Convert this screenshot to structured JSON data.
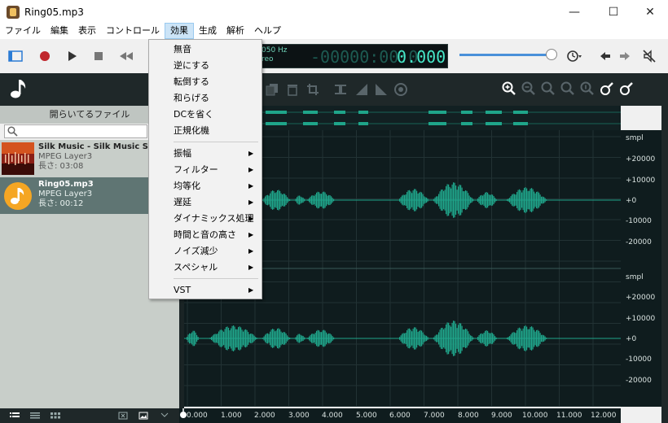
{
  "window": {
    "title": "Ring05.mp3"
  },
  "menubar": {
    "items": [
      "ファイル",
      "編集",
      "表示",
      "コントロール",
      "効果",
      "生成",
      "解析",
      "ヘルプ"
    ],
    "active": "効果"
  },
  "effects_menu": {
    "items_top": [
      "無音",
      "逆にする",
      "転倒する",
      "和らげる",
      "DCを省く",
      "正規化機"
    ],
    "items_sub": [
      "振幅",
      "フィルター",
      "均等化",
      "遅延",
      "ダイナミックス処理",
      "時間と音の高さ",
      "ノイズ減少",
      "スペシャル"
    ],
    "vst": "VST"
  },
  "display": {
    "info_line1": "050 Hz",
    "info_line2": "reo",
    "time_dim": "-00000:00:0",
    "time_value": "0.000"
  },
  "sidebar": {
    "header": "開らいてるファイル",
    "search_placeholder": "",
    "files": [
      {
        "name": "Silk Music - Silk Music Showca",
        "format": "MPEG Layer3",
        "length": "長さ: 03:08"
      },
      {
        "name": "Ring05.mp3",
        "format": "MPEG Layer3",
        "length": "長さ: 00:12"
      }
    ]
  },
  "ruler": {
    "unit": "smpl",
    "labels": [
      "+20000",
      "+10000",
      "+0",
      "-10000",
      "-20000"
    ]
  },
  "time_axis": {
    "labels": [
      "0.000",
      "1.000",
      "2.000",
      "3.000",
      "4.000",
      "5.000",
      "6.000",
      "7.000",
      "8.000",
      "9.000",
      "10.000",
      "11.000",
      "12.000"
    ]
  },
  "colors": {
    "accent": "#46e7c8",
    "waveform": "#1fa58a",
    "panel_dark": "#1f2829",
    "selected_row": "#5f7573"
  }
}
